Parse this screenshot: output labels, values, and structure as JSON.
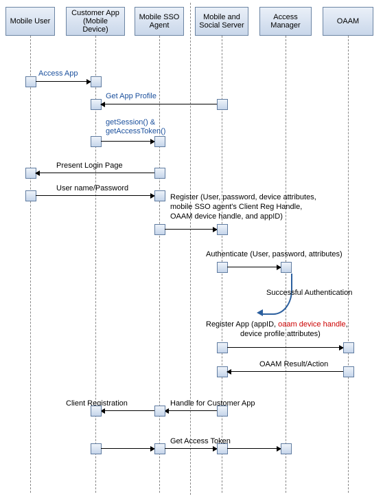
{
  "participants": {
    "p0": "Mobile User",
    "p1": "Customer App (Mobile Device)",
    "p2": "Mobile SSO Agent",
    "p3": "Mobile and Social Server",
    "p4": "Access Manager",
    "p5": "OAAM"
  },
  "messages": {
    "m1": "Access App",
    "m2": "Get App Profile",
    "m3a": "getSession() &",
    "m3b": "getAccessToken()",
    "m4": "Present Login Page",
    "m5": "User name/Password",
    "m6a": "Register (User, password, device attributes,",
    "m6b": "mobile SSO agent's Client Reg Handle,",
    "m6c": "OAAM device handle, and appID)",
    "m7": "Authenticate (User, password, attributes)",
    "m8": "Successful Authentication",
    "m9a": "Register App (appID, ",
    "m9b": "oaam device handle",
    "m9c": ",",
    "m9d": "device profile attributes)",
    "m10": "OAAM Result/Action",
    "m11": "Client Registration",
    "m12": "Handle for Customer App",
    "m13": "Get Access Token"
  },
  "chart_data": {
    "type": "sequence-diagram",
    "participants": [
      "Mobile User",
      "Customer App (Mobile Device)",
      "Mobile SSO Agent",
      "Mobile and Social Server",
      "Access Manager",
      "OAAM"
    ],
    "interactions": [
      {
        "from": "Mobile User",
        "to": "Customer App (Mobile Device)",
        "label": "Access App"
      },
      {
        "from": "Mobile and Social Server",
        "to": "Customer App (Mobile Device)",
        "label": "Get App Profile"
      },
      {
        "from": "Customer App (Mobile Device)",
        "to": "Mobile SSO Agent",
        "label": "getSession() & getAccessToken()"
      },
      {
        "from": "Mobile SSO Agent",
        "to": "Mobile User",
        "label": "Present Login Page"
      },
      {
        "from": "Mobile User",
        "to": "Mobile SSO Agent",
        "label": "User name/Password"
      },
      {
        "from": "Mobile SSO Agent",
        "to": "Mobile and Social Server",
        "label": "Register (User, password, device attributes, mobile SSO agent's Client Reg Handle, OAAM device handle, and appID)"
      },
      {
        "from": "Mobile and Social Server",
        "to": "Access Manager",
        "label": "Authenticate (User, password, attributes)"
      },
      {
        "from": "Access Manager",
        "to": "Mobile and Social Server",
        "label": "Successful Authentication",
        "style": "return-curve"
      },
      {
        "from": "Mobile and Social Server",
        "to": "OAAM",
        "label": "Register App (appID, oaam device handle, device profile attributes)"
      },
      {
        "from": "OAAM",
        "to": "Mobile and Social Server",
        "label": "OAAM Result/Action"
      },
      {
        "from": "Mobile and Social Server",
        "to": "Mobile SSO Agent",
        "label": "Handle for Customer App"
      },
      {
        "from": "Mobile SSO Agent",
        "to": "Customer App (Mobile Device)",
        "label": "Client Registration"
      },
      {
        "from": "Customer App (Mobile Device)",
        "to": "Access Manager",
        "label": "Get Access Token",
        "via": [
          "Mobile SSO Agent",
          "Mobile and Social Server"
        ]
      }
    ]
  }
}
